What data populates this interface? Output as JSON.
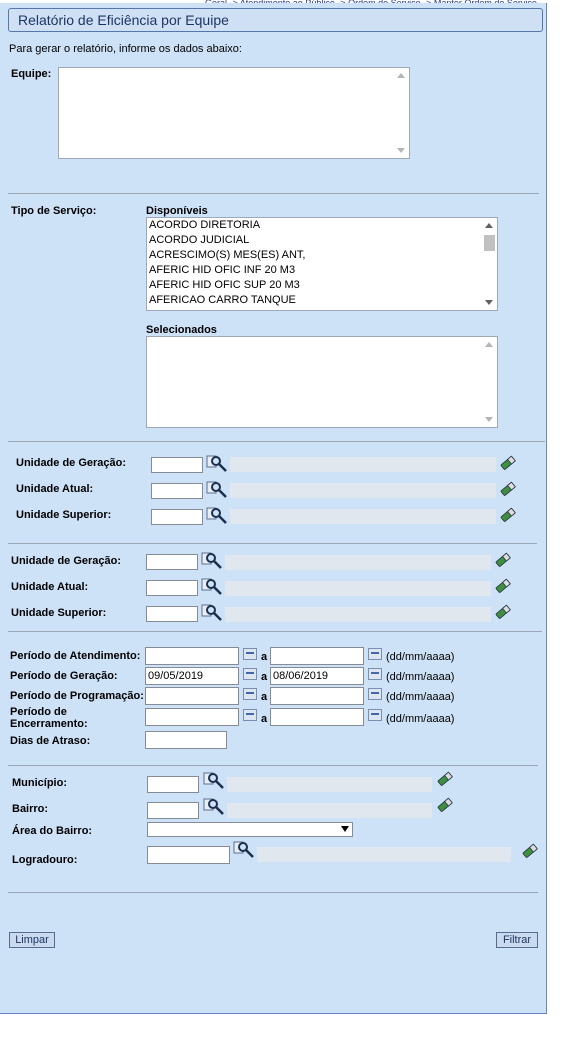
{
  "breadcrumb": "Geral -> Atendimento ao Público -> Ordem de Serviço -> Manter Ordem de Serviço",
  "page_title": "Relatório de Eficiência por Equipe",
  "intro": "Para gerar o relatório, informe os dados abaixo:",
  "equipe_label": "Equipe:",
  "tipo_servico": {
    "label": "Tipo de Serviço:",
    "disponiveis_label": "Disponíveis",
    "disponiveis": [
      "ACORDO DIRETORIA",
      "ACORDO JUDICIAL",
      "ACRESCIMO(S) MES(ES) ANT,",
      "AFERIC HID OFIC INF 20 M3",
      "AFERIC HID OFIC SUP 20 M3",
      "AFERICAO CARRO TANQUE"
    ],
    "selecionados_label": "Selecionados"
  },
  "unidades_1": {
    "geracao": "Unidade de Geração:",
    "atual": "Unidade Atual:",
    "superior": "Unidade Superior:"
  },
  "unidades_2": {
    "geracao": "Unidade de Geração:",
    "atual": "Unidade Atual:",
    "superior": "Unidade Superior:"
  },
  "periodos": {
    "separator": "a",
    "format": "(dd/mm/aaaa)",
    "atendimento_label": "Período de Atendimento:",
    "geracao_label": "Período de Geração:",
    "geracao_inicio": "09/05/2019",
    "geracao_fim": "08/06/2019",
    "programacao_label": "Período de Programação:",
    "encerramento_label": "Período de Encerramento:",
    "dias_atraso_label": "Dias de Atraso:"
  },
  "endereco": {
    "municipio": "Município:",
    "bairro": "Bairro:",
    "area_bairro": "Área do Bairro:",
    "logradouro": "Logradouro:"
  },
  "buttons": {
    "limpar": "Limpar",
    "filtrar": "Filtrar"
  }
}
